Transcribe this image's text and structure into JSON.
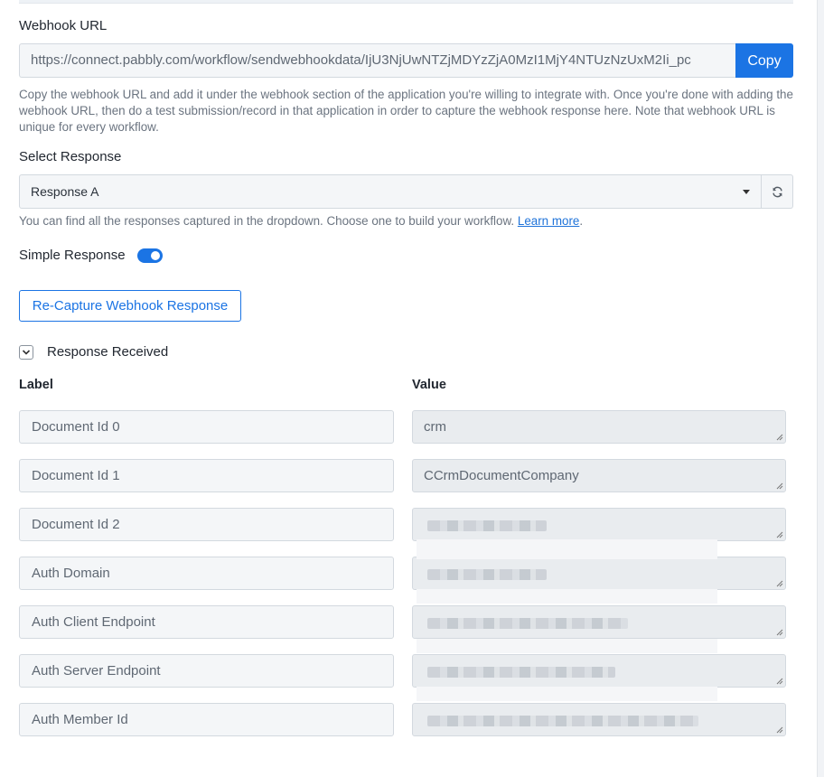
{
  "webhook": {
    "label": "Webhook URL",
    "url": "https://connect.pabbly.com/workflow/sendwebhookdata/IjU3NjUwNTZjMDYzZjA0MzI1MjY4NTUzNzUxM2Ii_pc",
    "copy_label": "Copy",
    "help": "Copy the webhook URL and add it under the webhook section of the application you're willing to integrate with. Once you're done with adding the webhook URL, then do a test submission/record in that application in order to capture the webhook response here. Note that webhook URL is unique for every workflow."
  },
  "select_response": {
    "label": "Select Response",
    "value": "Response A",
    "help_text": "You can find all the responses captured in the dropdown. Choose one to build your workflow.",
    "learn_more": "Learn more"
  },
  "simple_response": {
    "label": "Simple Response",
    "enabled": true
  },
  "recapture_label": "Re-Capture Webhook Response",
  "response_received": {
    "label": "Response Received",
    "col_label": "Label",
    "col_value": "Value",
    "rows": [
      {
        "label": "Document Id 0",
        "value": "crm"
      },
      {
        "label": "Document Id 1",
        "value": "CCrmDocumentCompany"
      },
      {
        "label": "Document Id 2",
        "value": ""
      },
      {
        "label": "Auth Domain",
        "value": ""
      },
      {
        "label": "Auth Client Endpoint",
        "value": ""
      },
      {
        "label": "Auth Server Endpoint",
        "value": ""
      },
      {
        "label": "Auth Member Id",
        "value": ""
      }
    ]
  },
  "colors": {
    "accent": "#1b74e4",
    "field_bg": "#f4f6f8",
    "readonly_bg": "#e9ecef"
  }
}
